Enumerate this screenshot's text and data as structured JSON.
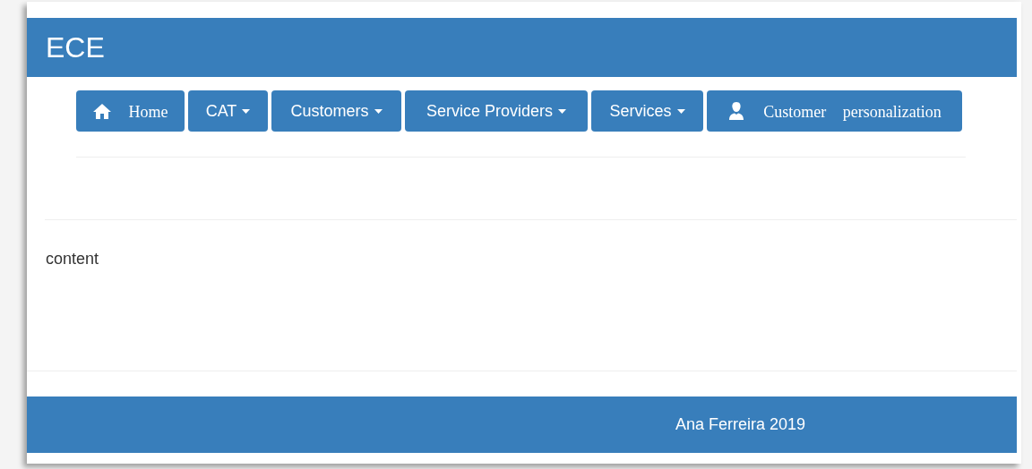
{
  "header": {
    "title": "ECE"
  },
  "nav": [
    {
      "kind": "home",
      "label": "Home"
    },
    {
      "kind": "dropdown",
      "label": "CAT"
    },
    {
      "kind": "dropdown",
      "label": "Customers"
    },
    {
      "kind": "dropdown",
      "label": "Service Providers"
    },
    {
      "kind": "dropdown",
      "label": "Services"
    },
    {
      "kind": "profile",
      "label": "Customer personalization"
    }
  ],
  "content": "content",
  "footer": "Ana Ferreira 2019"
}
